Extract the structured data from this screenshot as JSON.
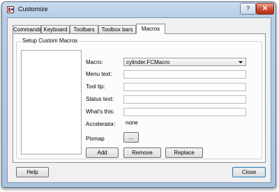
{
  "window": {
    "title": "Customize",
    "help_glyph": "?",
    "close_glyph": "✕"
  },
  "tabs": [
    {
      "label": "Commands",
      "active": false
    },
    {
      "label": "Keyboard",
      "active": false
    },
    {
      "label": "Toolbars",
      "active": false
    },
    {
      "label": "Toolbox bars",
      "active": false
    },
    {
      "label": "Macros",
      "active": true
    }
  ],
  "group": {
    "title": "Setup Custom Macros",
    "labels": {
      "macro": "Macro:",
      "menu_text": "Menu text:",
      "tool_tip": "Tool tip:",
      "status_text": "Status text:",
      "whats_this": "What's this:",
      "accelerator": "Accelerator:",
      "pixmap": "Pixmap"
    },
    "values": {
      "macro": "cylinder.FCMacro",
      "menu_text": "",
      "tool_tip": "",
      "status_text": "",
      "whats_this": "",
      "accelerator": "none"
    },
    "pixmap_button": "...",
    "buttons": {
      "add": "Add",
      "remove": "Remove",
      "replace": "Replace"
    }
  },
  "footer": {
    "help": "Help",
    "close": "Close"
  },
  "icons": [
    "app-icon",
    "help-icon",
    "close-icon",
    "chevron-down-icon"
  ]
}
